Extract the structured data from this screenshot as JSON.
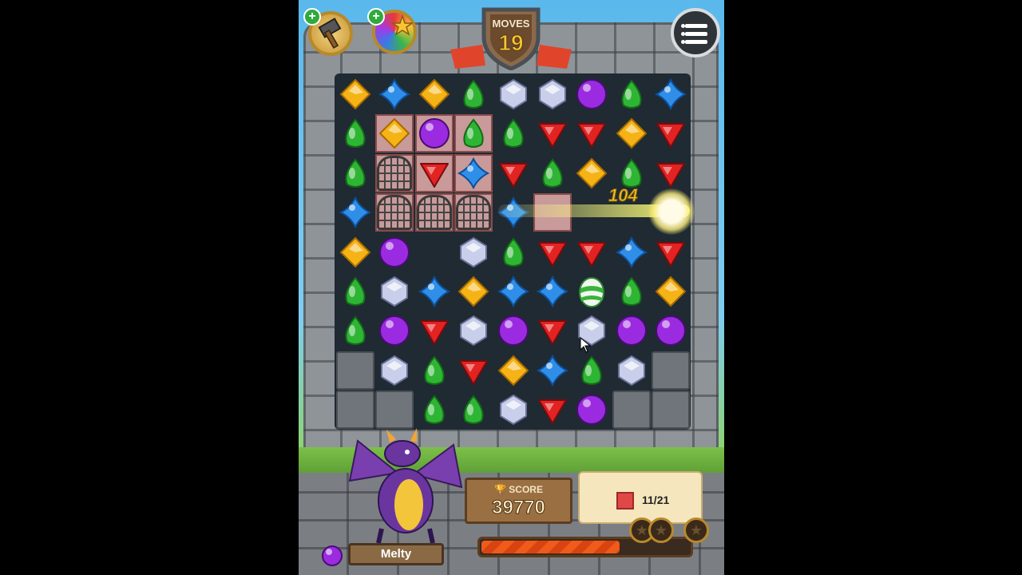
{
  "moves": {
    "label": "MOVES",
    "value": "19"
  },
  "score": {
    "label": "SCORE",
    "value": "39770"
  },
  "goal": {
    "text": "11/21",
    "progress": 11,
    "total": 21
  },
  "level_progress": 0.66,
  "character": {
    "name": "Melty"
  },
  "score_popup": "104",
  "colors": {
    "yellow": "#f5b316",
    "blue": "#2f8fe8",
    "green": "#2fb534",
    "white": "#c9cfea",
    "purple": "#9b2be0",
    "red": "#e32222"
  },
  "board": [
    [
      "yellow",
      "blue",
      "yellow",
      "green",
      "white",
      "white",
      "purple",
      "green",
      "blue"
    ],
    [
      "green",
      "yellow",
      "purple",
      "green",
      "green",
      "red",
      "red",
      "yellow",
      "red"
    ],
    [
      "green",
      "cage",
      "red",
      "blue",
      "red",
      "green",
      "yellow",
      "green",
      "red"
    ],
    [
      "blue",
      "cage",
      "cage",
      "cage",
      "blue",
      "tile",
      "glow",
      "glow",
      "burst"
    ],
    [
      "yellow",
      "purple",
      "empty",
      "white",
      "green",
      "red",
      "red",
      "blue",
      "red"
    ],
    [
      "green",
      "white",
      "blue",
      "yellow",
      "blue",
      "blue",
      "egg",
      "green",
      "yellow"
    ],
    [
      "green",
      "purple",
      "red",
      "white",
      "purple",
      "red",
      "white",
      "purple",
      "purple"
    ],
    [
      "stone",
      "white",
      "green",
      "red",
      "yellow",
      "blue",
      "green",
      "white",
      "stone"
    ],
    [
      "stone",
      "stone",
      "green",
      "green",
      "white",
      "red",
      "purple",
      "stone",
      "stone"
    ]
  ]
}
